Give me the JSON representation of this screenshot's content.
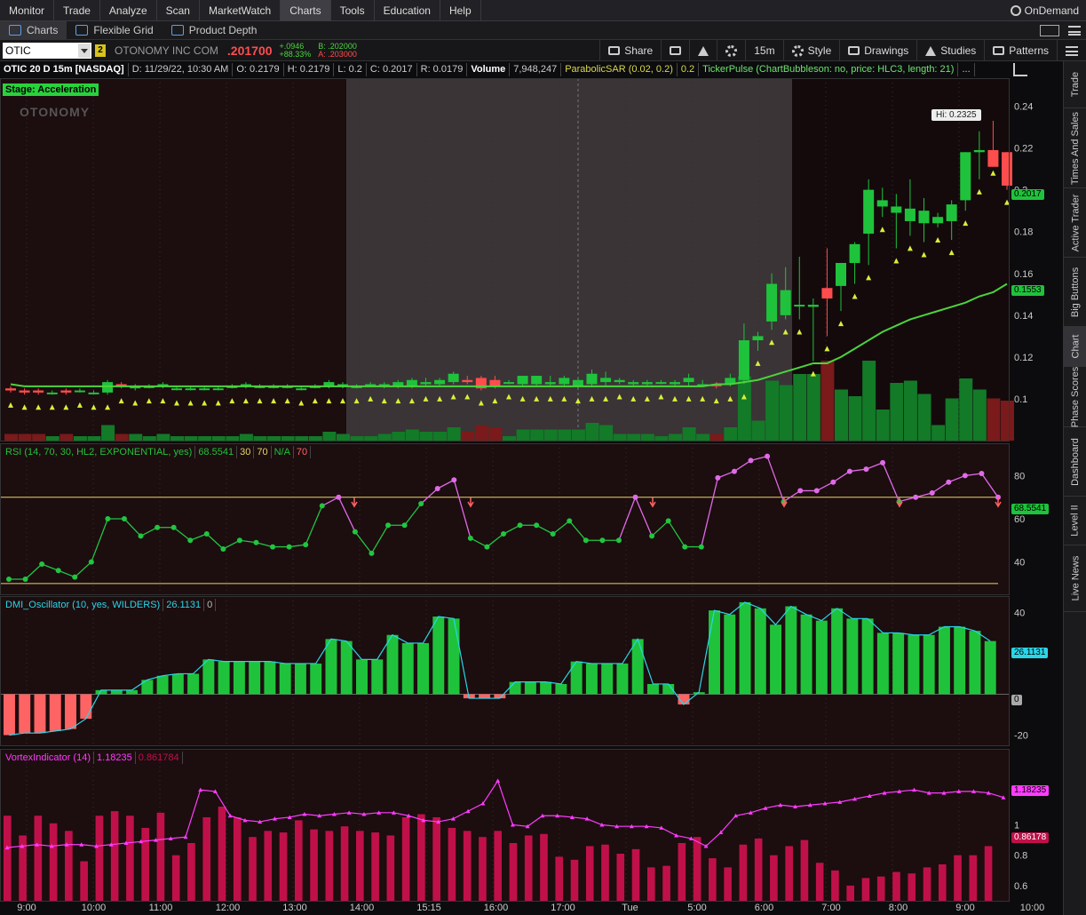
{
  "menu": {
    "items": [
      "Monitor",
      "Trade",
      "Analyze",
      "Scan",
      "MarketWatch",
      "Charts",
      "Tools",
      "Education",
      "Help"
    ],
    "active": "Charts",
    "ondemand": "OnDemand"
  },
  "subtabs": {
    "charts": "Charts",
    "flexible_grid": "Flexible Grid",
    "product_depth": "Product Depth"
  },
  "toolbar": {
    "symbol": "OTIC",
    "link": "2",
    "company": "OTONOMY INC COM",
    "last": ".201700",
    "change": "+.0946",
    "change_pct": "+88.33%",
    "bid": "B: .202000",
    "ask": "A: .203000",
    "share": "Share",
    "timeframe": "15m",
    "style": "Style",
    "drawings": "Drawings",
    "studies": "Studies",
    "patterns": "Patterns"
  },
  "header": {
    "title": "OTIC 20 D 15m [NASDAQ]",
    "date": "D: 11/29/22, 10:30 AM",
    "open": "O: 0.2179",
    "high": "H: 0.2179",
    "low": "L: 0.2",
    "close": "C: 0.2017",
    "range": "R: 0.0179",
    "volume_label": "Volume",
    "volume": "7,948,247",
    "sar": "ParabolicSAR (0.02, 0.2)",
    "sar_val": "0.2",
    "tickerpulse": "TickerPulse (ChartBubbleson: no, price: HLC3, length: 21)",
    "more": "..."
  },
  "overlay": {
    "stage": "Stage: Acceleration",
    "watermark": "OTONOMY",
    "hi": "Hi: 0.2325",
    "last_tag": "0.2017",
    "ma_tag": "0.1553"
  },
  "rsi": {
    "label": "RSI (14, 70, 30, HL2, EXPONENTIAL, yes)",
    "value": "68.5541",
    "ob": "30",
    "os": "70",
    "na": "N/A",
    "x": "70"
  },
  "dmi": {
    "label": "DMI_Oscillator (10, yes, WILDERS)",
    "value": "26.1131",
    "zero": "0"
  },
  "vortex": {
    "label": "VortexIndicator (14)",
    "vip": "1.18235",
    "vim": "0.861784",
    "tag_vip": "1.18235",
    "tag_vim": "0.86178"
  },
  "price_ticks": [
    "0.24",
    "0.22",
    "0.2",
    "0.18",
    "0.16",
    "0.14",
    "0.12",
    "0.1"
  ],
  "rsi_ticks": [
    "80",
    "60",
    "40"
  ],
  "dmi_ticks": [
    "40",
    "20",
    "0",
    "-20"
  ],
  "vortex_ticks": [
    "1",
    "0.8",
    "0.6"
  ],
  "time_labels": [
    "9:00",
    "10:00",
    "11:00",
    "12:00",
    "13:00",
    "14:00",
    "15:15",
    "16:00",
    "17:00",
    "Tue",
    "5:00",
    "6:00",
    "7:00",
    "8:00",
    "9:00",
    "10:00"
  ],
  "sidebar": [
    "Trade",
    "Times And Sales",
    "Active Trader",
    "Big Buttons",
    "Chart",
    "Phase Scores",
    "Dashboard",
    "Level II",
    "Live News"
  ],
  "colors": {
    "up": "#1fc33b",
    "down": "#ff4d4d",
    "sar": "#d8f03a",
    "ma": "#4cd43c",
    "rsi": "#21c540",
    "rsi_ob": "#e06ae8",
    "vip": "#ff3cff",
    "vim_bar": "#c0104a",
    "dmi_up": "#1fc33b",
    "dmi_down": "#ff6464"
  },
  "chart_data": [
    {
      "type": "candlestick",
      "title": "OTIC 20 D 15m [NASDAQ]",
      "ylim": [
        0.08,
        0.25
      ],
      "candles": [
        [
          0.105,
          0.106,
          0.103,
          0.104
        ],
        [
          0.104,
          0.105,
          0.102,
          0.103
        ],
        [
          0.104,
          0.105,
          0.102,
          0.103
        ],
        [
          0.103,
          0.104,
          0.102,
          0.103
        ],
        [
          0.104,
          0.105,
          0.102,
          0.103
        ],
        [
          0.104,
          0.105,
          0.103,
          0.104
        ],
        [
          0.103,
          0.104,
          0.102,
          0.103
        ],
        [
          0.103,
          0.109,
          0.102,
          0.108
        ],
        [
          0.107,
          0.108,
          0.105,
          0.106
        ],
        [
          0.105,
          0.107,
          0.104,
          0.106
        ],
        [
          0.106,
          0.107,
          0.105,
          0.106
        ],
        [
          0.106,
          0.108,
          0.105,
          0.107
        ],
        [
          0.105,
          0.106,
          0.104,
          0.105
        ],
        [
          0.105,
          0.106,
          0.104,
          0.105
        ],
        [
          0.105,
          0.106,
          0.104,
          0.105
        ],
        [
          0.105,
          0.106,
          0.104,
          0.105
        ],
        [
          0.106,
          0.107,
          0.105,
          0.106
        ],
        [
          0.106,
          0.108,
          0.105,
          0.107
        ],
        [
          0.106,
          0.107,
          0.105,
          0.106
        ],
        [
          0.106,
          0.107,
          0.105,
          0.106
        ],
        [
          0.106,
          0.107,
          0.105,
          0.106
        ],
        [
          0.105,
          0.106,
          0.104,
          0.105
        ],
        [
          0.106,
          0.107,
          0.105,
          0.106
        ],
        [
          0.106,
          0.109,
          0.105,
          0.108
        ],
        [
          0.106,
          0.108,
          0.105,
          0.107
        ],
        [
          0.106,
          0.107,
          0.105,
          0.106
        ],
        [
          0.107,
          0.108,
          0.106,
          0.107
        ],
        [
          0.106,
          0.108,
          0.105,
          0.107
        ],
        [
          0.106,
          0.109,
          0.105,
          0.108
        ],
        [
          0.106,
          0.11,
          0.105,
          0.109
        ],
        [
          0.107,
          0.11,
          0.106,
          0.108
        ],
        [
          0.107,
          0.11,
          0.106,
          0.109
        ],
        [
          0.108,
          0.113,
          0.107,
          0.112
        ],
        [
          0.109,
          0.111,
          0.107,
          0.108
        ],
        [
          0.11,
          0.111,
          0.104,
          0.105
        ],
        [
          0.109,
          0.111,
          0.105,
          0.106
        ],
        [
          0.108,
          0.109,
          0.107,
          0.108
        ],
        [
          0.107,
          0.111,
          0.106,
          0.111
        ],
        [
          0.107,
          0.111,
          0.106,
          0.111
        ],
        [
          0.107,
          0.111,
          0.106,
          0.108
        ],
        [
          0.107,
          0.111,
          0.106,
          0.11
        ],
        [
          0.106,
          0.11,
          0.105,
          0.109
        ],
        [
          0.107,
          0.114,
          0.106,
          0.112
        ],
        [
          0.108,
          0.113,
          0.106,
          0.11
        ],
        [
          0.108,
          0.11,
          0.107,
          0.109
        ],
        [
          0.107,
          0.109,
          0.106,
          0.108
        ],
        [
          0.107,
          0.109,
          0.106,
          0.108
        ],
        [
          0.108,
          0.109,
          0.107,
          0.108
        ],
        [
          0.107,
          0.109,
          0.106,
          0.108
        ],
        [
          0.108,
          0.112,
          0.106,
          0.11
        ],
        [
          0.107,
          0.109,
          0.106,
          0.107
        ],
        [
          0.107,
          0.108,
          0.105,
          0.106
        ],
        [
          0.107,
          0.112,
          0.106,
          0.11
        ],
        [
          0.109,
          0.136,
          0.107,
          0.128
        ],
        [
          0.128,
          0.132,
          0.123,
          0.13
        ],
        [
          0.137,
          0.16,
          0.133,
          0.155
        ],
        [
          0.14,
          0.163,
          0.138,
          0.152
        ],
        [
          0.145,
          0.168,
          0.138,
          0.145
        ],
        [
          0.144,
          0.148,
          0.118,
          0.145
        ],
        [
          0.153,
          0.172,
          0.13,
          0.148
        ],
        [
          0.154,
          0.165,
          0.142,
          0.165
        ],
        [
          0.165,
          0.175,
          0.155,
          0.174
        ],
        [
          0.179,
          0.205,
          0.164,
          0.2
        ],
        [
          0.192,
          0.201,
          0.187,
          0.195
        ],
        [
          0.189,
          0.198,
          0.172,
          0.192
        ],
        [
          0.185,
          0.205,
          0.178,
          0.191
        ],
        [
          0.184,
          0.196,
          0.175,
          0.19
        ],
        [
          0.184,
          0.189,
          0.182,
          0.187
        ],
        [
          0.185,
          0.195,
          0.176,
          0.193
        ],
        [
          0.195,
          0.218,
          0.19,
          0.218
        ],
        [
          0.218,
          0.228,
          0.205,
          0.219
        ],
        [
          0.219,
          0.233,
          0.214,
          0.211
        ],
        [
          0.218,
          0.218,
          0.2,
          0.202
        ]
      ],
      "ma": [
        0.107,
        0.106,
        0.106,
        0.106,
        0.106,
        0.106,
        0.106,
        0.106,
        0.106,
        0.106,
        0.106,
        0.106,
        0.106,
        0.106,
        0.106,
        0.106,
        0.106,
        0.106,
        0.106,
        0.106,
        0.106,
        0.106,
        0.106,
        0.106,
        0.106,
        0.106,
        0.106,
        0.106,
        0.106,
        0.106,
        0.106,
        0.106,
        0.106,
        0.106,
        0.106,
        0.106,
        0.106,
        0.106,
        0.106,
        0.106,
        0.106,
        0.106,
        0.106,
        0.106,
        0.106,
        0.106,
        0.106,
        0.106,
        0.106,
        0.106,
        0.106,
        0.107,
        0.107,
        0.108,
        0.109,
        0.111,
        0.113,
        0.115,
        0.117,
        0.117,
        0.12,
        0.124,
        0.128,
        0.132,
        0.135,
        0.138,
        0.14,
        0.142,
        0.144,
        0.146,
        0.149,
        0.151,
        0.155
      ]
    },
    {
      "type": "line",
      "title": "RSI (14, 70, 30, HL2, EXPONENTIAL, yes)",
      "ylim": [
        25,
        95
      ],
      "values": [
        32,
        32,
        39,
        36,
        33,
        40,
        60,
        60,
        52,
        56,
        56,
        50,
        53,
        46,
        50,
        49,
        47,
        47,
        48,
        66,
        70,
        54,
        44,
        57,
        57,
        67,
        74,
        78,
        51,
        47,
        53,
        57,
        57,
        53,
        59,
        50,
        50,
        50,
        70,
        52,
        59,
        47,
        47,
        79,
        82,
        87,
        89,
        68,
        73,
        73,
        77,
        82,
        83,
        86,
        68,
        70,
        72,
        77,
        80,
        81,
        70
      ],
      "ob_level": 70,
      "os_level": 30
    },
    {
      "type": "bar",
      "title": "DMI_Oscillator (10, yes, WILDERS)",
      "ylim": [
        -25,
        48
      ],
      "values": [
        -20,
        -19,
        -19,
        -18,
        -17,
        -12,
        2,
        2,
        2,
        7,
        9,
        10,
        10,
        17,
        16,
        16,
        16,
        16,
        15,
        15,
        15,
        27,
        26,
        17,
        17,
        29,
        25,
        25,
        38,
        37,
        -2,
        -2,
        -2,
        6,
        6,
        6,
        5,
        16,
        15,
        15,
        15,
        27,
        5,
        5,
        -5,
        1,
        41,
        39,
        45,
        42,
        34,
        43,
        39,
        36,
        42,
        37,
        37,
        30,
        30,
        29,
        29,
        33,
        33,
        31,
        26
      ],
      "zero": 0
    },
    {
      "type": "line",
      "title": "VortexIndicator (14)",
      "ylim": [
        0.5,
        1.5
      ],
      "series": [
        {
          "name": "1.18235",
          "values": [
            0.85,
            0.86,
            0.87,
            0.86,
            0.87,
            0.87,
            0.86,
            0.87,
            0.88,
            0.89,
            0.9,
            0.91,
            0.92,
            1.23,
            1.22,
            1.06,
            1.03,
            1.02,
            1.04,
            1.05,
            1.07,
            1.06,
            1.07,
            1.08,
            1.07,
            1.08,
            1.08,
            1.06,
            1.03,
            1.02,
            1.04,
            1.09,
            1.14,
            1.29,
            1.0,
            0.99,
            1.06,
            1.06,
            1.05,
            1.04,
            1.0,
            0.99,
            0.99,
            0.99,
            0.98,
            0.93,
            0.91,
            0.86,
            0.95,
            1.06,
            1.08,
            1.11,
            1.13,
            1.12,
            1.13,
            1.14,
            1.15,
            1.17,
            1.19,
            1.21,
            1.22,
            1.23,
            1.21,
            1.21,
            1.22,
            1.22,
            1.21,
            1.18
          ]
        },
        {
          "name": "0.861784",
          "values": [
            1.06,
            0.93,
            1.06,
            1.01,
            0.96,
            0.76,
            1.06,
            1.09,
            1.06,
            0.98,
            1.08,
            0.8,
            0.88,
            1.05,
            1.12,
            1.05,
            0.92,
            0.96,
            0.95,
            1.03,
            0.97,
            0.96,
            0.99,
            0.96,
            0.95,
            0.93,
            1.05,
            1.07,
            1.05,
            0.98,
            0.96,
            0.92,
            0.96,
            0.88,
            0.93,
            0.94,
            0.79,
            0.77,
            0.86,
            0.87,
            0.81,
            0.84,
            0.72,
            0.73,
            0.88,
            0.92,
            0.78,
            0.72,
            0.87,
            0.91,
            0.8,
            0.86,
            0.9,
            0.75,
            0.7,
            0.6,
            0.65,
            0.66,
            0.69,
            0.68,
            0.72,
            0.74,
            0.8,
            0.8,
            0.86
          ]
        }
      ]
    }
  ]
}
